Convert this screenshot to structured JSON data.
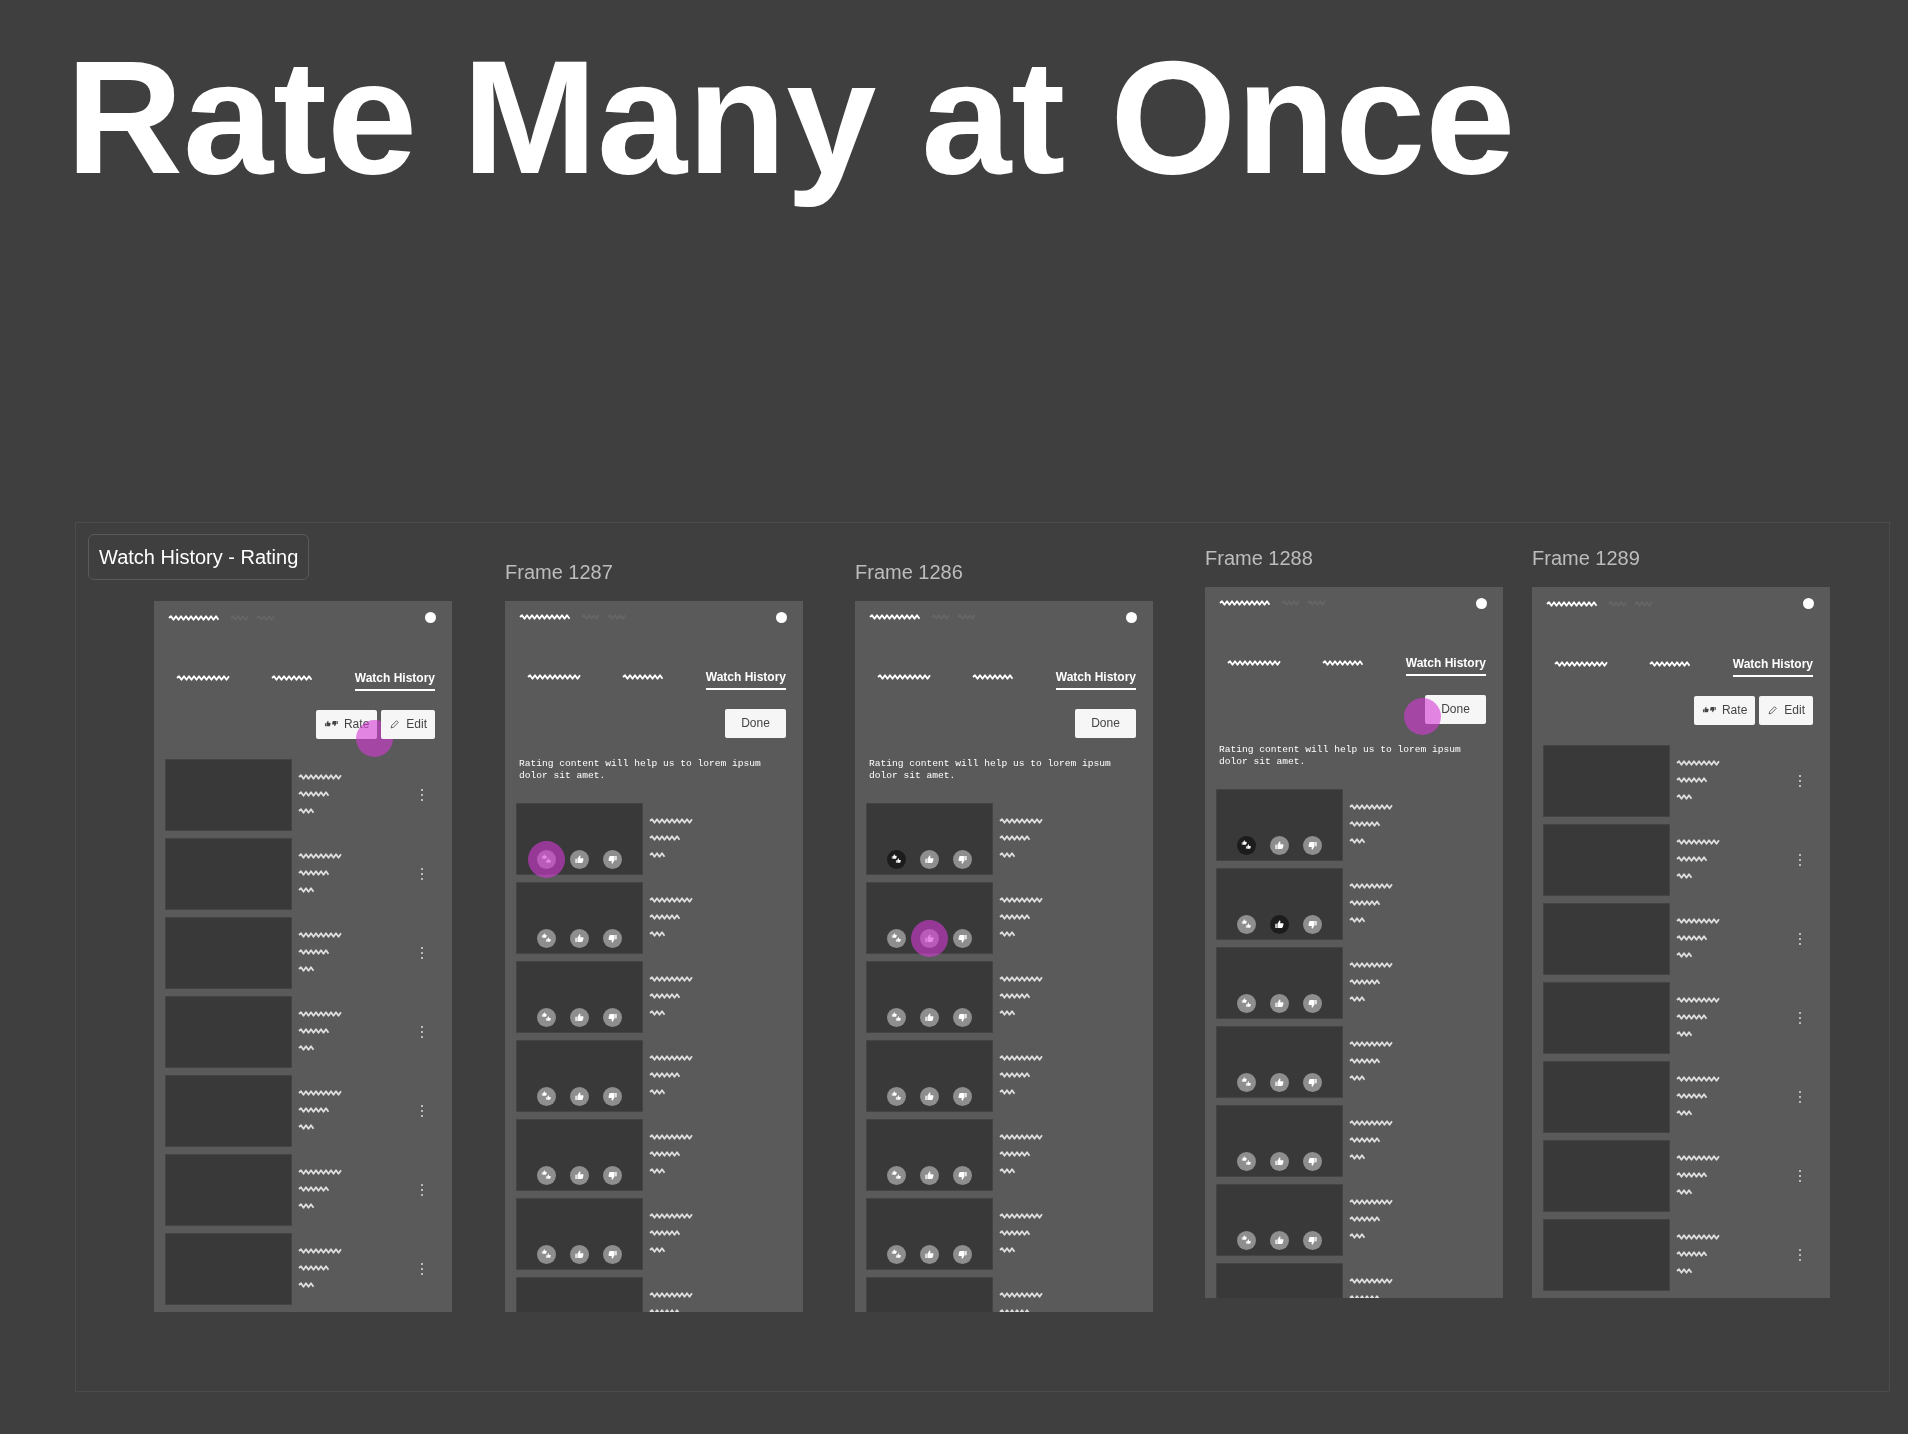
{
  "title": "Rate Many at Once",
  "section": {
    "label": "Watch History - Rating"
  },
  "frames": [
    {
      "tabs": [
        {
          "kind": "scribble",
          "selected": false
        },
        {
          "kind": "scribble",
          "selected": false
        },
        {
          "kind": "text",
          "label": "Watch History",
          "selected": true
        }
      ],
      "buttons": [
        {
          "kind": "rate",
          "label": "Rate",
          "tapped": true
        },
        {
          "kind": "edit",
          "label": "Edit",
          "tapped": false
        }
      ],
      "items": [
        {
          "kind": "more"
        },
        {
          "kind": "more"
        },
        {
          "kind": "more"
        },
        {
          "kind": "more"
        },
        {
          "kind": "more"
        },
        {
          "kind": "more"
        },
        {
          "kind": "more"
        }
      ]
    },
    {
      "label": "Frame 1287",
      "tabs": [
        {
          "kind": "scribble",
          "selected": false
        },
        {
          "kind": "scribble",
          "selected": false
        },
        {
          "kind": "text",
          "label": "Watch History",
          "selected": true
        }
      ],
      "buttons": [
        {
          "kind": "done",
          "label": "Done",
          "tapped": false
        }
      ],
      "message": "Rating content will help us to lorem ipsum dolor sit amet.",
      "items": [
        {
          "kind": "rate",
          "options": [
            {
              "kind": "mixed",
              "selected": false,
              "tapped": true
            },
            {
              "kind": "up",
              "selected": false,
              "tapped": false
            },
            {
              "kind": "down",
              "selected": false,
              "tapped": false
            }
          ]
        },
        {
          "kind": "rate",
          "options": [
            {
              "kind": "mixed",
              "selected": false,
              "tapped": false
            },
            {
              "kind": "up",
              "selected": false,
              "tapped": false
            },
            {
              "kind": "down",
              "selected": false,
              "tapped": false
            }
          ]
        },
        {
          "kind": "rate",
          "options": [
            {
              "kind": "mixed",
              "selected": false,
              "tapped": false
            },
            {
              "kind": "up",
              "selected": false,
              "tapped": false
            },
            {
              "kind": "down",
              "selected": false,
              "tapped": false
            }
          ]
        },
        {
          "kind": "rate",
          "options": [
            {
              "kind": "mixed",
              "selected": false,
              "tapped": false
            },
            {
              "kind": "up",
              "selected": false,
              "tapped": false
            },
            {
              "kind": "down",
              "selected": false,
              "tapped": false
            }
          ]
        },
        {
          "kind": "rate",
          "options": [
            {
              "kind": "mixed",
              "selected": false,
              "tapped": false
            },
            {
              "kind": "up",
              "selected": false,
              "tapped": false
            },
            {
              "kind": "down",
              "selected": false,
              "tapped": false
            }
          ]
        },
        {
          "kind": "rate",
          "options": [
            {
              "kind": "mixed",
              "selected": false,
              "tapped": false
            },
            {
              "kind": "up",
              "selected": false,
              "tapped": false
            },
            {
              "kind": "down",
              "selected": false,
              "tapped": false
            }
          ]
        },
        {
          "kind": "rate"
        }
      ]
    },
    {
      "label": "Frame 1286",
      "tabs": [
        {
          "kind": "scribble",
          "selected": false
        },
        {
          "kind": "scribble",
          "selected": false
        },
        {
          "kind": "text",
          "label": "Watch History",
          "selected": true
        }
      ],
      "buttons": [
        {
          "kind": "done",
          "label": "Done",
          "tapped": false
        }
      ],
      "message": "Rating content will help us to lorem ipsum dolor sit amet.",
      "items": [
        {
          "kind": "rate",
          "options": [
            {
              "kind": "mixed",
              "selected": true,
              "tapped": false
            },
            {
              "kind": "up",
              "selected": false,
              "tapped": false
            },
            {
              "kind": "down",
              "selected": false,
              "tapped": false
            }
          ]
        },
        {
          "kind": "rate",
          "options": [
            {
              "kind": "mixed",
              "selected": false,
              "tapped": false
            },
            {
              "kind": "up",
              "selected": false,
              "tapped": true
            },
            {
              "kind": "down",
              "selected": false,
              "tapped": false
            }
          ]
        },
        {
          "kind": "rate",
          "options": [
            {
              "kind": "mixed",
              "selected": false,
              "tapped": false
            },
            {
              "kind": "up",
              "selected": false,
              "tapped": false
            },
            {
              "kind": "down",
              "selected": false,
              "tapped": false
            }
          ]
        },
        {
          "kind": "rate",
          "options": [
            {
              "kind": "mixed",
              "selected": false,
              "tapped": false
            },
            {
              "kind": "up",
              "selected": false,
              "tapped": false
            },
            {
              "kind": "down",
              "selected": false,
              "tapped": false
            }
          ]
        },
        {
          "kind": "rate",
          "options": [
            {
              "kind": "mixed",
              "selected": false,
              "tapped": false
            },
            {
              "kind": "up",
              "selected": false,
              "tapped": false
            },
            {
              "kind": "down",
              "selected": false,
              "tapped": false
            }
          ]
        },
        {
          "kind": "rate",
          "options": [
            {
              "kind": "mixed",
              "selected": false,
              "tapped": false
            },
            {
              "kind": "up",
              "selected": false,
              "tapped": false
            },
            {
              "kind": "down",
              "selected": false,
              "tapped": false
            }
          ]
        },
        {
          "kind": "rate"
        }
      ]
    },
    {
      "label": "Frame 1288",
      "tabs": [
        {
          "kind": "scribble",
          "selected": false
        },
        {
          "kind": "scribble",
          "selected": false
        },
        {
          "kind": "text",
          "label": "Watch History",
          "selected": true
        }
      ],
      "buttons": [
        {
          "kind": "done",
          "label": "Done",
          "tapped": true
        }
      ],
      "message": "Rating content will help us to lorem ipsum dolor sit amet.",
      "items": [
        {
          "kind": "rate",
          "options": [
            {
              "kind": "mixed",
              "selected": true,
              "tapped": false
            },
            {
              "kind": "up",
              "selected": false,
              "tapped": false
            },
            {
              "kind": "down",
              "selected": false,
              "tapped": false
            }
          ]
        },
        {
          "kind": "rate",
          "options": [
            {
              "kind": "mixed",
              "selected": false,
              "tapped": false
            },
            {
              "kind": "up",
              "selected": true,
              "tapped": false
            },
            {
              "kind": "down",
              "selected": false,
              "tapped": false
            }
          ]
        },
        {
          "kind": "rate",
          "options": [
            {
              "kind": "mixed",
              "selected": false,
              "tapped": false
            },
            {
              "kind": "up",
              "selected": false,
              "tapped": false
            },
            {
              "kind": "down",
              "selected": false,
              "tapped": false
            }
          ]
        },
        {
          "kind": "rate",
          "options": [
            {
              "kind": "mixed",
              "selected": false,
              "tapped": false
            },
            {
              "kind": "up",
              "selected": false,
              "tapped": false
            },
            {
              "kind": "down",
              "selected": false,
              "tapped": false
            }
          ]
        },
        {
          "kind": "rate",
          "options": [
            {
              "kind": "mixed",
              "selected": false,
              "tapped": false
            },
            {
              "kind": "up",
              "selected": false,
              "tapped": false
            },
            {
              "kind": "down",
              "selected": false,
              "tapped": false
            }
          ]
        },
        {
          "kind": "rate",
          "options": [
            {
              "kind": "mixed",
              "selected": false,
              "tapped": false
            },
            {
              "kind": "up",
              "selected": false,
              "tapped": false
            },
            {
              "kind": "down",
              "selected": false,
              "tapped": false
            }
          ]
        },
        {
          "kind": "rate"
        }
      ]
    },
    {
      "label": "Frame 1289",
      "tabs": [
        {
          "kind": "scribble",
          "selected": false
        },
        {
          "kind": "scribble",
          "selected": false
        },
        {
          "kind": "text",
          "label": "Watch History",
          "selected": true
        }
      ],
      "buttons": [
        {
          "kind": "rate",
          "label": "Rate",
          "tapped": false
        },
        {
          "kind": "edit",
          "label": "Edit",
          "tapped": false
        }
      ],
      "items": [
        {
          "kind": "more"
        },
        {
          "kind": "more"
        },
        {
          "kind": "more"
        },
        {
          "kind": "more"
        },
        {
          "kind": "more"
        },
        {
          "kind": "more"
        },
        {
          "kind": "more"
        }
      ]
    }
  ]
}
